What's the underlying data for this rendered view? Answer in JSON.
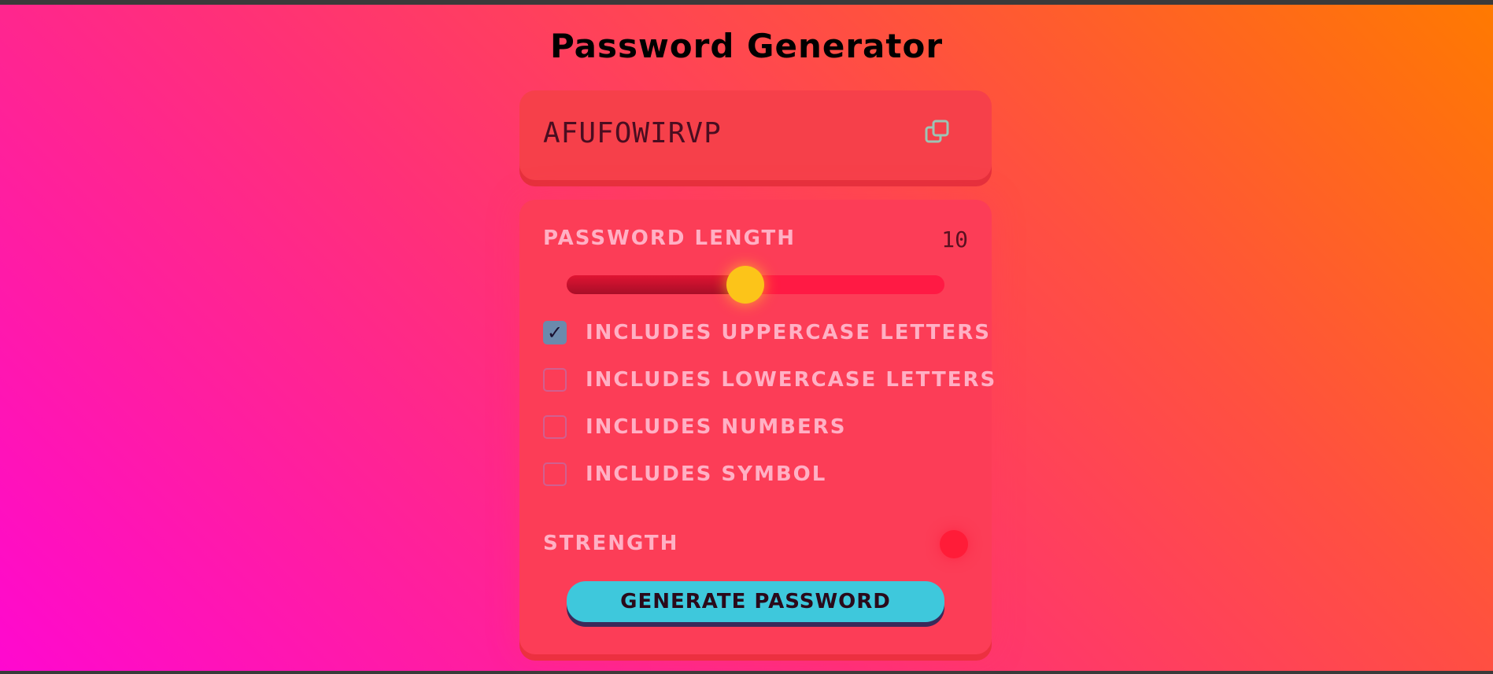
{
  "app": {
    "title": "Password Generator"
  },
  "display": {
    "password": "AFUFOWIRVP",
    "copy_icon": "copy-icon"
  },
  "settings": {
    "length_label": "Password Length",
    "length_value": "10",
    "slider": {
      "min": 1,
      "max": 20,
      "value": 10
    },
    "options": [
      {
        "label": "Includes Uppercase Letters",
        "checked": true
      },
      {
        "label": "Includes Lowercase Letters",
        "checked": false
      },
      {
        "label": "Includes Numbers",
        "checked": false
      },
      {
        "label": "Includes Symbol",
        "checked": false
      }
    ],
    "strength_label": "Strength",
    "strength_color": "#ff1c38"
  },
  "actions": {
    "generate_label": "Generate Password"
  },
  "colors": {
    "accent": "#fcc419",
    "button": "#3ec8dc"
  }
}
